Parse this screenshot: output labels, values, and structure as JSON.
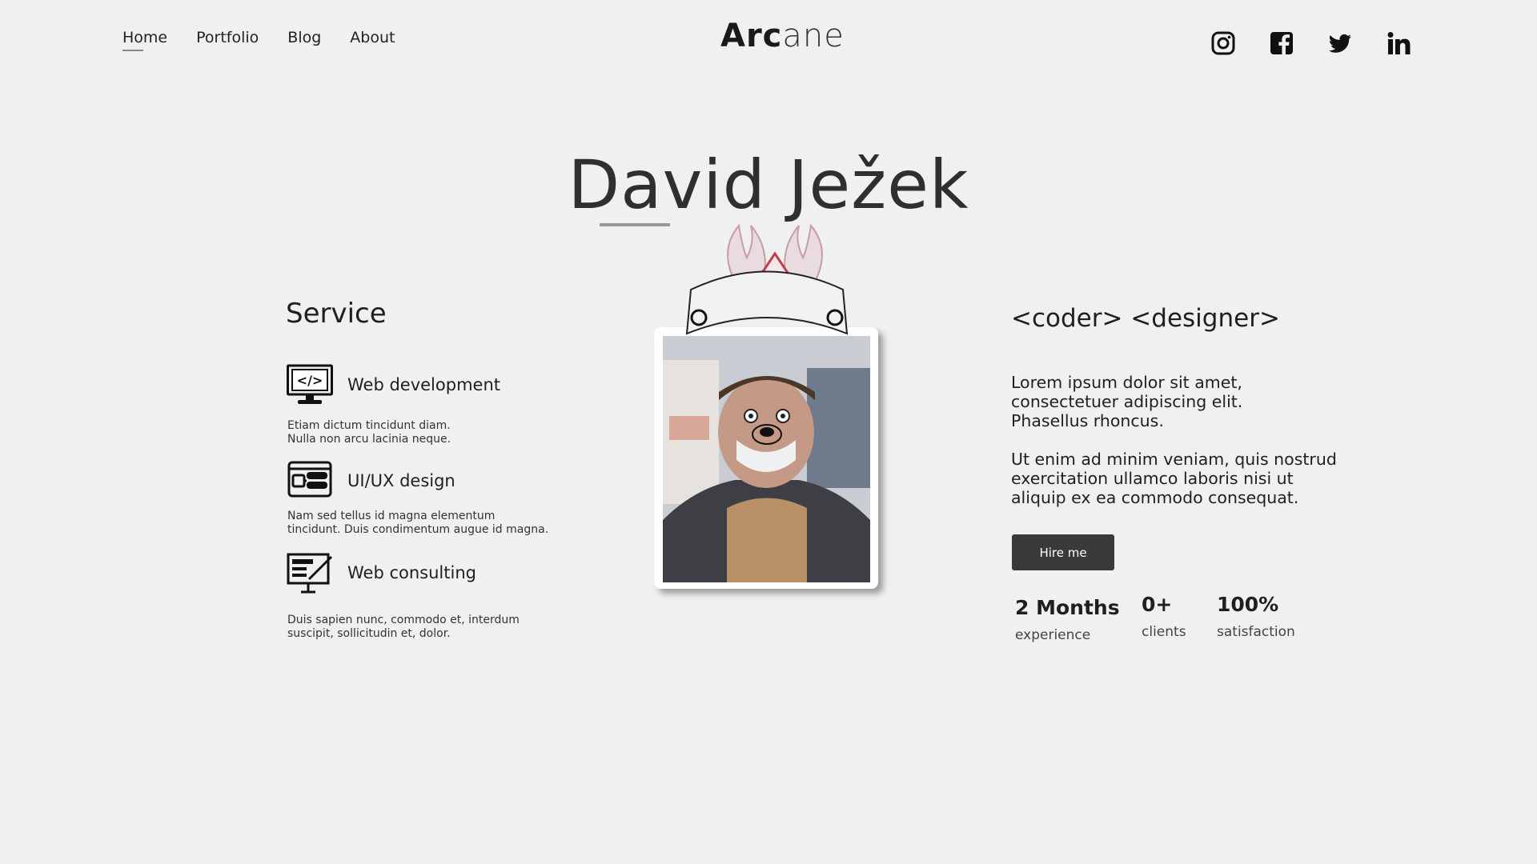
{
  "nav": {
    "items": [
      {
        "label": "Home"
      },
      {
        "label": "Portfolio"
      },
      {
        "label": "Blog"
      },
      {
        "label": "About"
      }
    ]
  },
  "logo": {
    "bold": "Arc",
    "light": "ane"
  },
  "socials": [
    "instagram-icon",
    "facebook-icon",
    "twitter-icon",
    "linkedin-icon"
  ],
  "hero": {
    "name": "David Ježek"
  },
  "services": {
    "title": "Service",
    "items": [
      {
        "icon": "code-monitor-icon",
        "label": "Web development",
        "desc1": "Etiam dictum tincidunt diam.",
        "desc2": "Nulla non arcu lacinia neque."
      },
      {
        "icon": "ui-window-icon",
        "label": "UI/UX design",
        "desc1": "Nam sed tellus id magna elementum",
        "desc2": "tincidunt. Duis condimentum augue id magna."
      },
      {
        "icon": "consulting-board-icon",
        "label": "Web consulting",
        "desc1": "Duis sapien nunc, commodo et, interdum",
        "desc2": "suscipit, sollicitudin et, dolor."
      }
    ]
  },
  "profile": {
    "tagline": "<coder> <designer>",
    "para1": [
      "Lorem ipsum dolor sit amet,",
      "consectetuer adipiscing elit.",
      "Phasellus rhoncus."
    ],
    "para2": [
      "Ut enim ad minim veniam, quis nostrud",
      "exercitation ullamco laboris nisi ut",
      "aliquip ex ea commodo consequat."
    ],
    "hire_label": "Hire me",
    "stats": [
      {
        "value": "2 Months",
        "label": "experience"
      },
      {
        "value": "0+",
        "label": "clients"
      },
      {
        "value": "100%",
        "label": "satisfaction"
      }
    ]
  }
}
